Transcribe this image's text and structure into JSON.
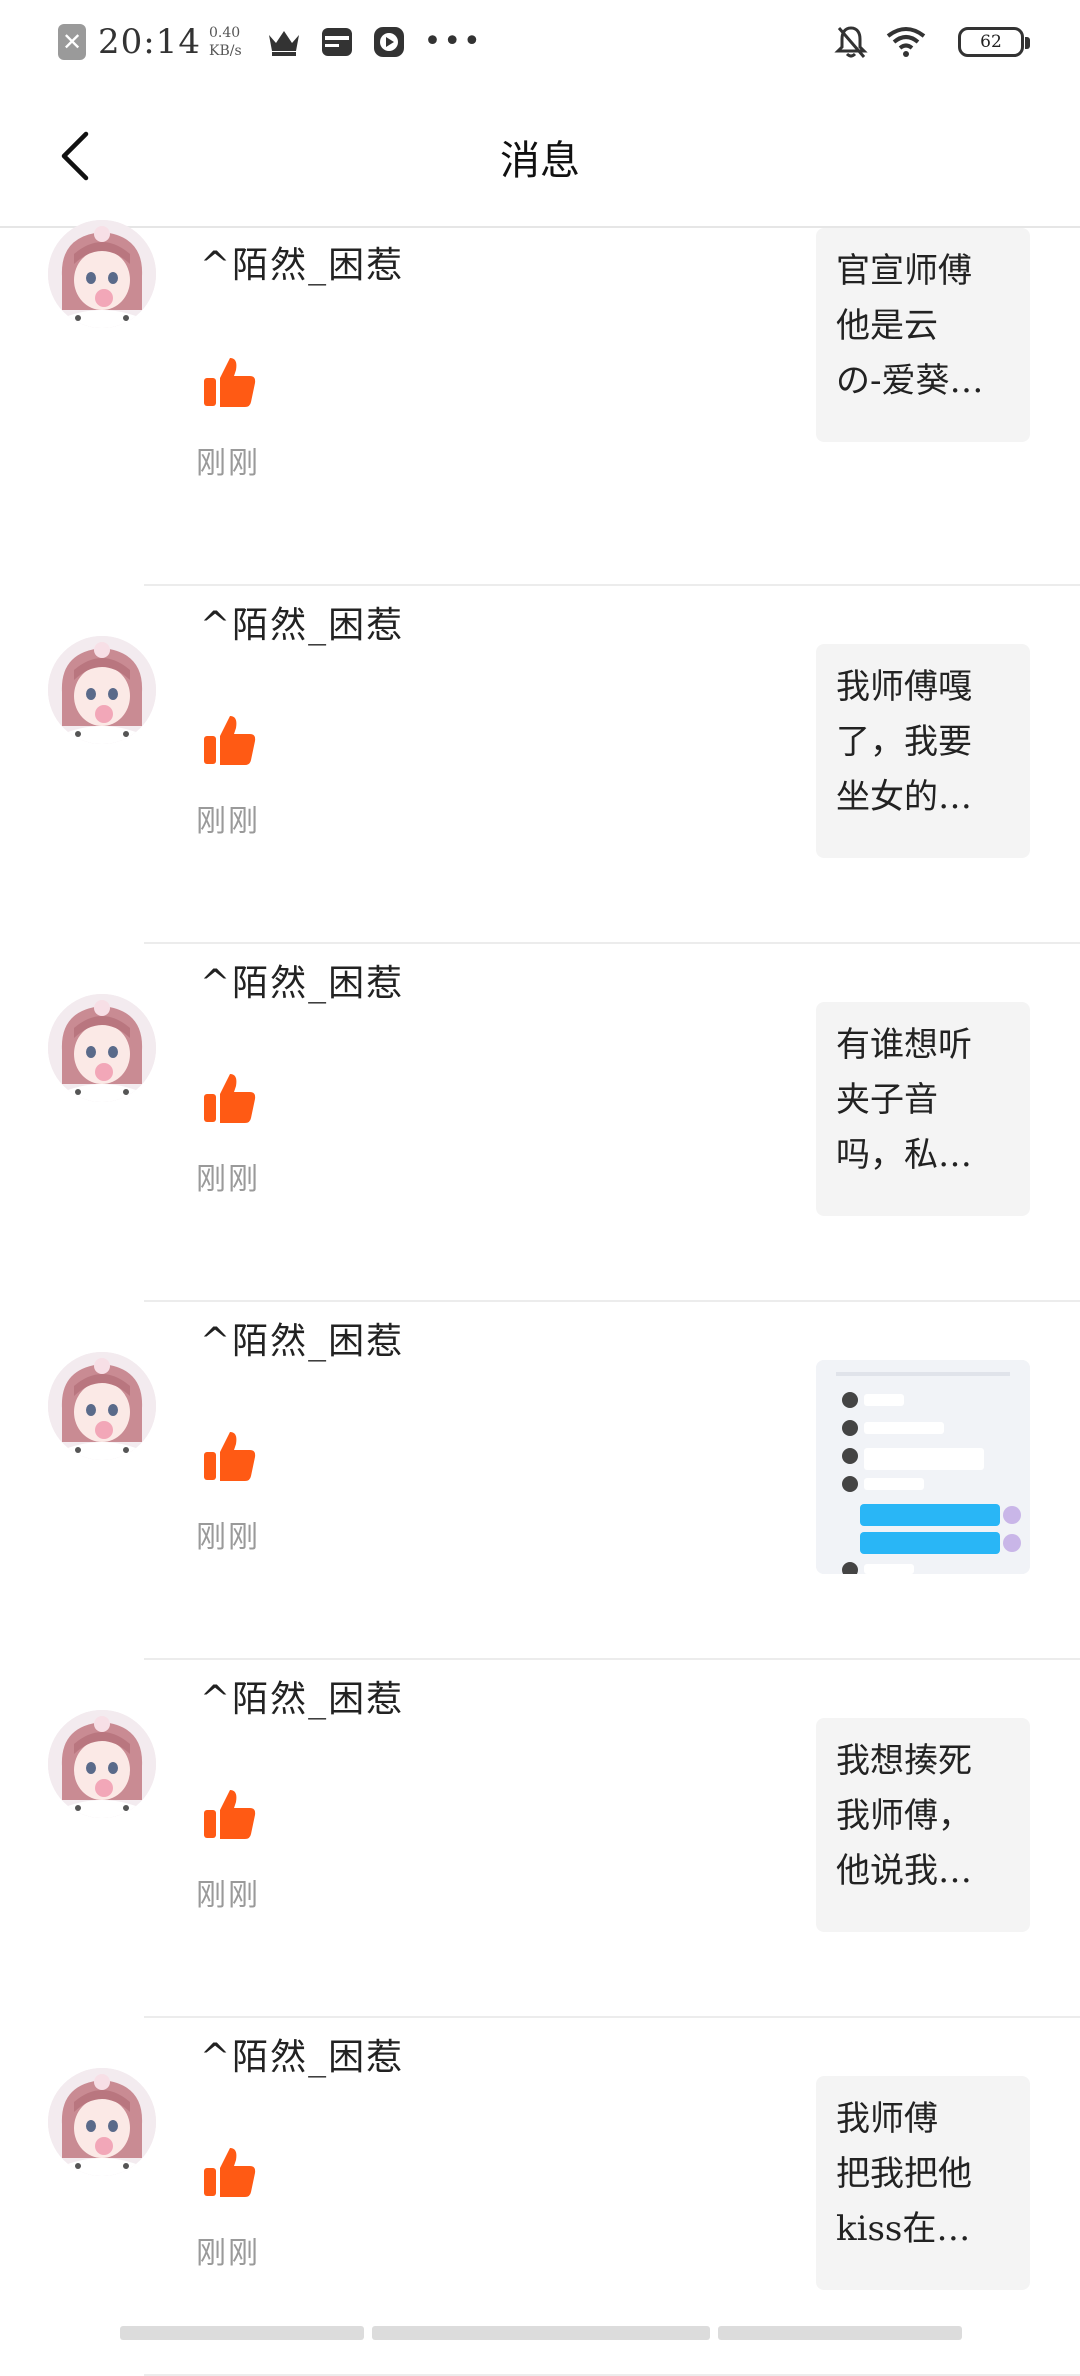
{
  "status_bar": {
    "time": "20:14",
    "speed_value": "0.40",
    "speed_unit": "KB/s",
    "more": "•••",
    "battery": "62"
  },
  "header": {
    "title": "消息"
  },
  "messages": [
    {
      "user": "^陌然_困惹",
      "time": "刚刚",
      "post_lines": [
        "官宣师傅",
        "他是云",
        "の-爱葵…"
      ]
    },
    {
      "user": "^陌然_困惹",
      "time": "刚刚",
      "post_lines": [
        "我师傅嘎",
        "了，我要",
        "坐女的…"
      ]
    },
    {
      "user": "^陌然_困惹",
      "time": "刚刚",
      "post_lines": [
        "有谁想听",
        "夹子音",
        "吗，私…"
      ]
    },
    {
      "user": "^陌然_困惹",
      "time": "刚刚",
      "post_lines": []
    },
    {
      "user": "^陌然_困惹",
      "time": "刚刚",
      "post_lines": [
        "我想揍死",
        "我师傅，",
        "他说我…"
      ]
    },
    {
      "user": "^陌然_困惹",
      "time": "刚刚",
      "post_lines": [
        "我师傅",
        "把我把他",
        "kiss在…"
      ]
    }
  ],
  "colors": {
    "accent": "#FF5A14"
  },
  "icons": {
    "like": "thumbs-up-icon",
    "back": "chevron-left-icon"
  }
}
